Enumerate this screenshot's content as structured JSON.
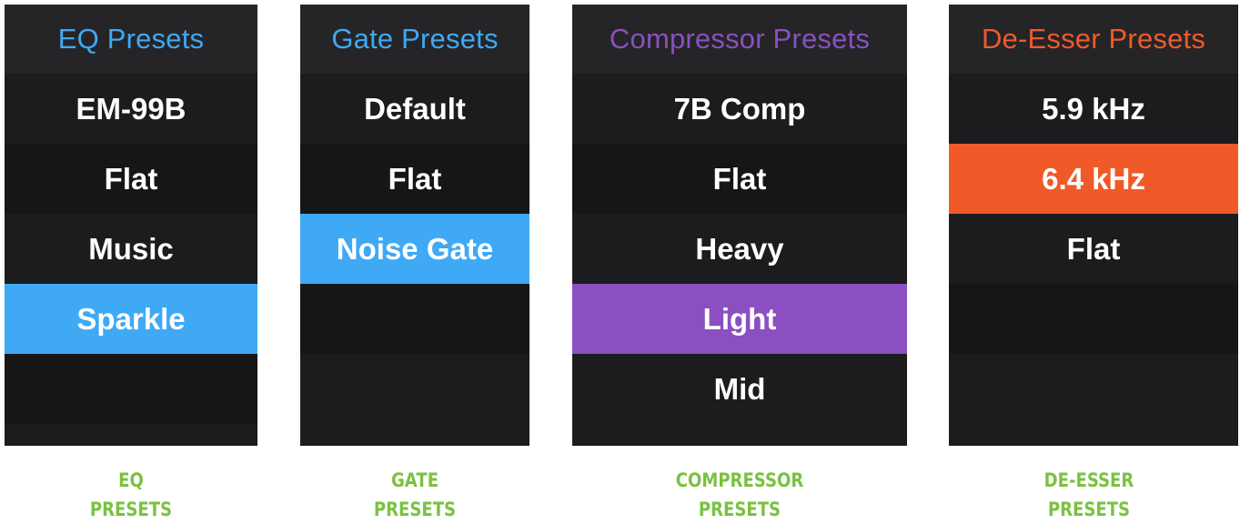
{
  "colors": {
    "eq_accent": "#3fa9f5",
    "gate_accent": "#3fa9f5",
    "compressor_accent": "#8b4fc1",
    "deesser_accent": "#f05a28",
    "caption_green": "#7bc142",
    "panel_bg": "#1c1c1e"
  },
  "panels": [
    {
      "id": "eq",
      "title": "EQ Presets",
      "items": [
        {
          "label": "EM-99B",
          "selected": false
        },
        {
          "label": "Flat",
          "selected": false
        },
        {
          "label": "Music",
          "selected": false
        },
        {
          "label": "Sparkle",
          "selected": true
        },
        {
          "label": "",
          "selected": false
        }
      ],
      "caption_line1": "EQ",
      "caption_line2": "PRESETS"
    },
    {
      "id": "gate",
      "title": "Gate Presets",
      "items": [
        {
          "label": "Default",
          "selected": false
        },
        {
          "label": "Flat",
          "selected": false
        },
        {
          "label": "Noise Gate",
          "selected": true
        },
        {
          "label": "",
          "selected": false
        },
        {
          "label": "",
          "selected": false
        }
      ],
      "caption_line1": "GATE",
      "caption_line2": "PRESETS"
    },
    {
      "id": "compressor",
      "title": "Compressor Presets",
      "items": [
        {
          "label": "7B Comp",
          "selected": false
        },
        {
          "label": "Flat",
          "selected": false
        },
        {
          "label": "Heavy",
          "selected": false
        },
        {
          "label": "Light",
          "selected": true
        },
        {
          "label": "Mid",
          "selected": false
        }
      ],
      "caption_line1": "COMPRESSOR",
      "caption_line2": "PRESETS"
    },
    {
      "id": "deesser",
      "title": "De-Esser Presets",
      "items": [
        {
          "label": "5.9 kHz",
          "selected": false
        },
        {
          "label": "6.4 kHz",
          "selected": true
        },
        {
          "label": "Flat",
          "selected": false
        },
        {
          "label": "",
          "selected": false
        },
        {
          "label": "",
          "selected": false
        }
      ],
      "caption_line1": "DE-ESSER",
      "caption_line2": "PRESETS"
    }
  ]
}
